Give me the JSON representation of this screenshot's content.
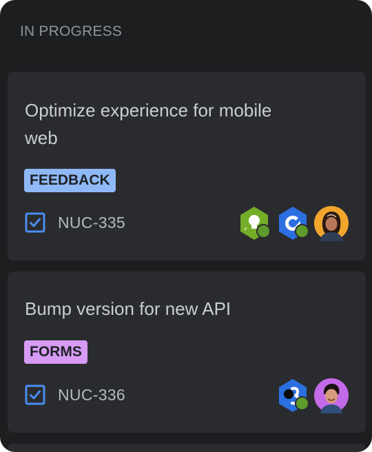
{
  "column": {
    "title": "IN PROGRESS"
  },
  "cards": [
    {
      "title": "Optimize experience for mobile web",
      "label": "FEEDBACK",
      "label_color": "#8fb8f6",
      "key": "NUC-335",
      "icon": "task-checkbox-icon",
      "assignees": [
        "lightbulb-app-avatar",
        "wrench-app-avatar",
        "user-avatar-woman"
      ]
    },
    {
      "title": "Bump version for new API",
      "label": "FORMS",
      "label_color": "#d79bf4",
      "key": "NUC-336",
      "icon": "task-checkbox-icon",
      "assignees": [
        "number-three-app-avatar",
        "user-avatar-man"
      ]
    }
  ],
  "colors": {
    "column_bg": "#1d1e20",
    "card_bg": "#2a2b2e",
    "task_icon": "#4b8df2",
    "online_dot": "#5e9b2b"
  }
}
